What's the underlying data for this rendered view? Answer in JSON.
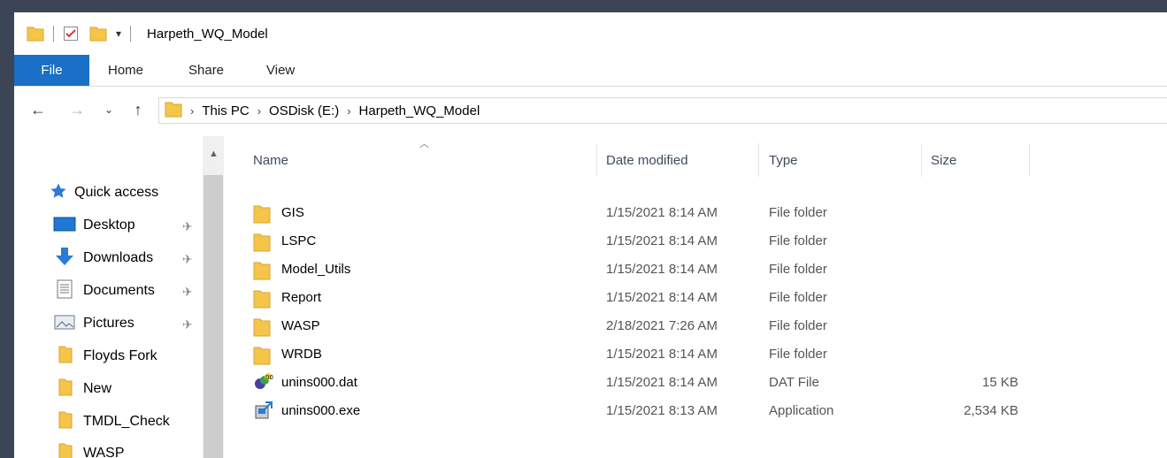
{
  "title_bar": {
    "title": "Harpeth_WQ_Model"
  },
  "ribbon": {
    "tabs": [
      "File",
      "Home",
      "Share",
      "View"
    ]
  },
  "address": {
    "crumbs": [
      "This PC",
      "OSDisk (E:)",
      "Harpeth_WQ_Model"
    ]
  },
  "nav_pane": {
    "items": [
      {
        "label": "Quick access",
        "icon": "star-icon",
        "pinned": false
      },
      {
        "label": "Desktop",
        "icon": "desktop-icon",
        "pinned": true
      },
      {
        "label": "Downloads",
        "icon": "download-icon",
        "pinned": true
      },
      {
        "label": "Documents",
        "icon": "documents-icon",
        "pinned": true
      },
      {
        "label": "Pictures",
        "icon": "pictures-icon",
        "pinned": true
      },
      {
        "label": "Floyds Fork",
        "icon": "folder-icon",
        "pinned": false
      },
      {
        "label": "New",
        "icon": "folder-icon",
        "pinned": false
      },
      {
        "label": "TMDL_Check",
        "icon": "folder-icon",
        "pinned": false
      },
      {
        "label": "WASP",
        "icon": "folder-icon",
        "pinned": false
      }
    ]
  },
  "columns": {
    "name": "Name",
    "date": "Date modified",
    "type": "Type",
    "size": "Size"
  },
  "files": [
    {
      "name": "GIS",
      "date": "1/15/2021 8:14 AM",
      "type": "File folder",
      "size": "",
      "icon": "folder-icon"
    },
    {
      "name": "LSPC",
      "date": "1/15/2021 8:14 AM",
      "type": "File folder",
      "size": "",
      "icon": "folder-icon"
    },
    {
      "name": "Model_Utils",
      "date": "1/15/2021 8:14 AM",
      "type": "File folder",
      "size": "",
      "icon": "folder-icon"
    },
    {
      "name": "Report",
      "date": "1/15/2021 8:14 AM",
      "type": "File folder",
      "size": "",
      "icon": "folder-icon"
    },
    {
      "name": "WASP",
      "date": "2/18/2021 7:26 AM",
      "type": "File folder",
      "size": "",
      "icon": "folder-icon"
    },
    {
      "name": "WRDB",
      "date": "1/15/2021 8:14 AM",
      "type": "File folder",
      "size": "",
      "icon": "folder-icon"
    },
    {
      "name": "unins000.dat",
      "date": "1/15/2021 8:14 AM",
      "type": "DAT File",
      "size": "15 KB",
      "icon": "dat-file-icon"
    },
    {
      "name": "unins000.exe",
      "date": "1/15/2021 8:13 AM",
      "type": "Application",
      "size": "2,534 KB",
      "icon": "installer-icon"
    }
  ],
  "colors": {
    "file_tab": "#1a6fc6",
    "folder": "#f5c54a",
    "desktop_bg": "#3b4556"
  }
}
